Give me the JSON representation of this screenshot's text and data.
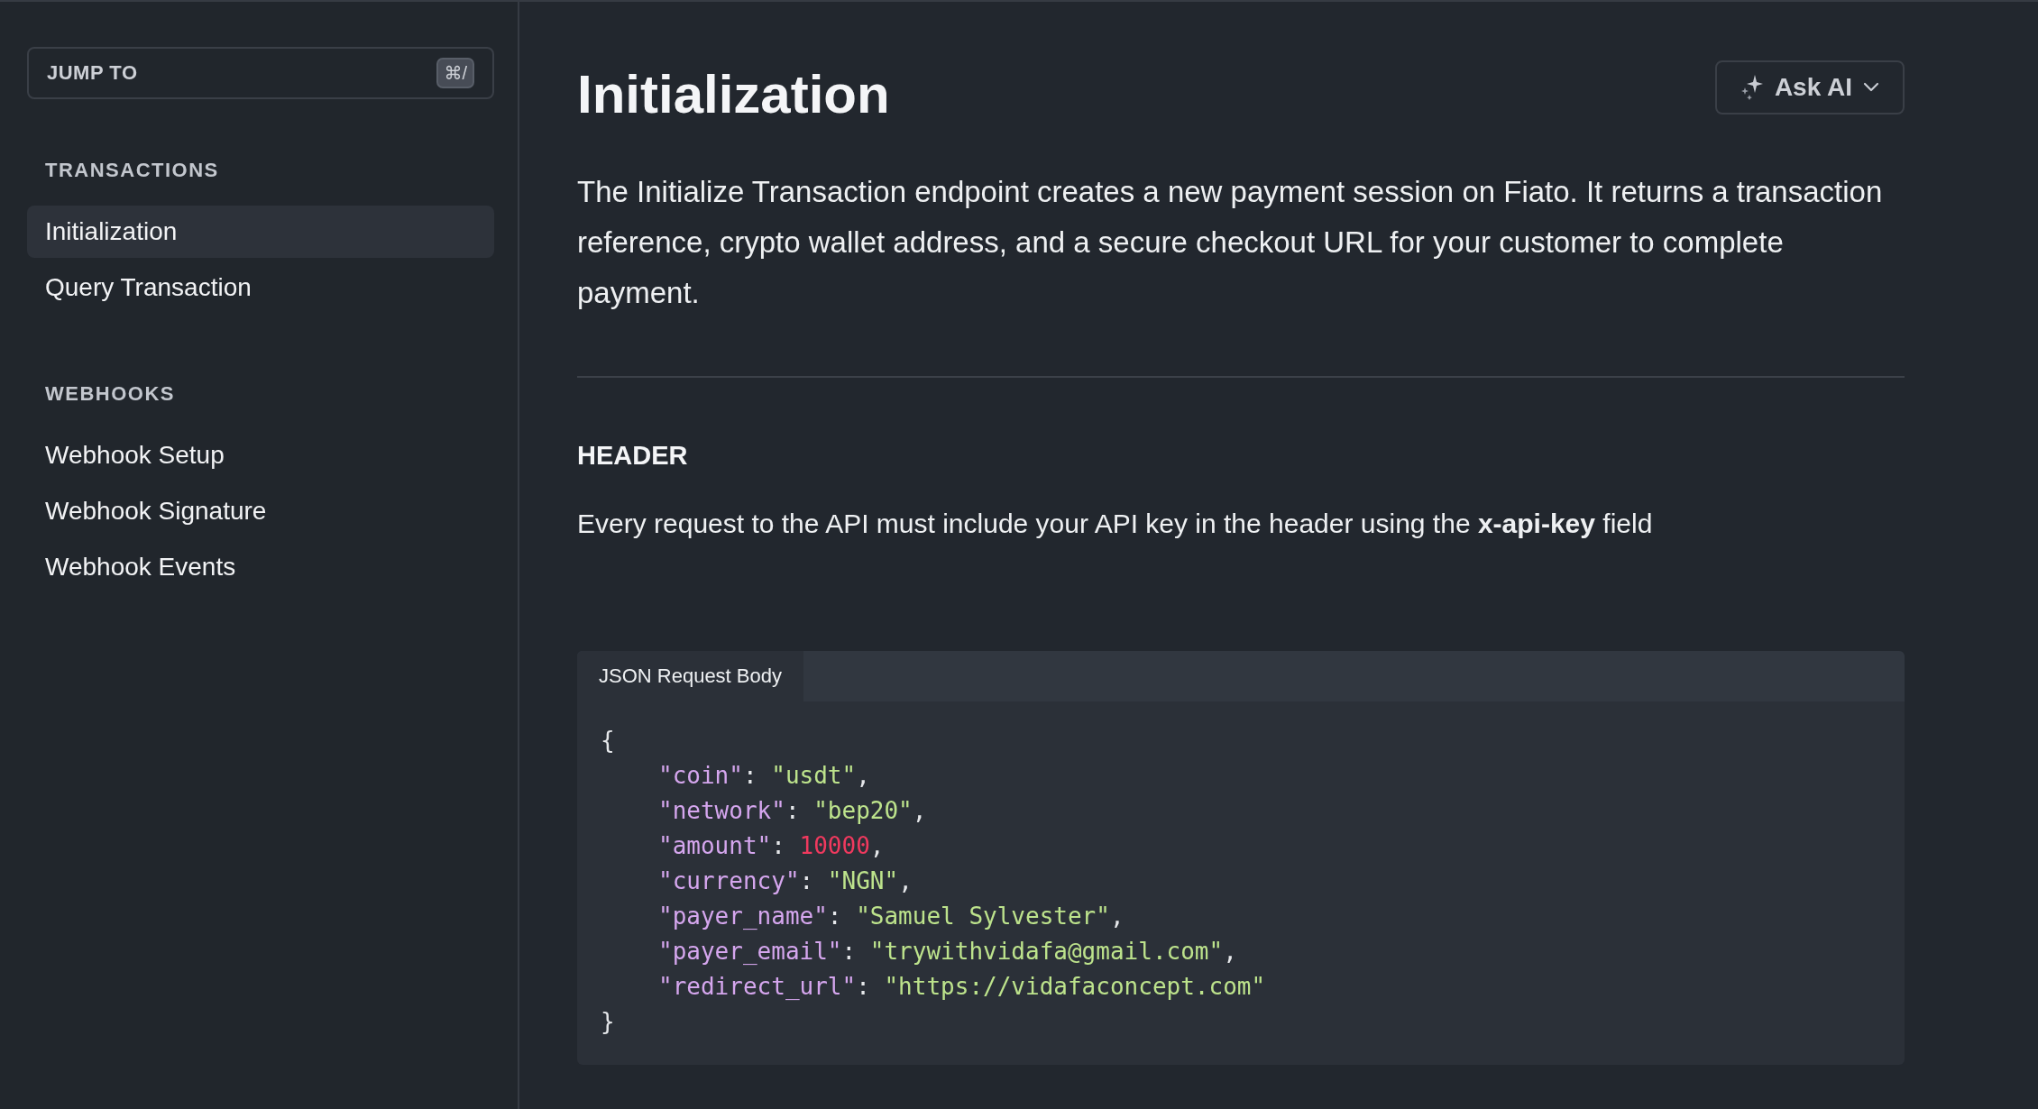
{
  "sidebar": {
    "jump_to": {
      "label": "JUMP TO",
      "shortcut": "⌘/"
    },
    "sections": [
      {
        "title": "TRANSACTIONS",
        "items": [
          {
            "label": "Initialization",
            "selected": true
          },
          {
            "label": "Query Transaction",
            "selected": false
          }
        ]
      },
      {
        "title": "WEBHOOKS",
        "items": [
          {
            "label": "Webhook Setup",
            "selected": false
          },
          {
            "label": "Webhook Signature",
            "selected": false
          },
          {
            "label": "Webhook Events",
            "selected": false
          }
        ]
      }
    ]
  },
  "page": {
    "title": "Initialization",
    "ask_ai": {
      "label": "Ask AI"
    },
    "intro": "The Initialize Transaction endpoint creates a new payment session on Fiato. It returns a transaction reference, crypto wallet address, and a secure checkout URL for your customer to complete payment.",
    "header_section": {
      "title": "HEADER",
      "text": "Every request to the API must include your API key in the header using the **x-api-key** field"
    },
    "code_block": {
      "tab": "JSON Request Body",
      "lines": [
        {
          "indented": false,
          "tokens": [
            {
              "kind": "punct",
              "text": "{"
            }
          ]
        },
        {
          "indented": true,
          "tokens": [
            {
              "kind": "key",
              "text": "\"coin\""
            },
            {
              "kind": "punct",
              "text": ": "
            },
            {
              "kind": "string",
              "text": "\"usdt\""
            },
            {
              "kind": "punct",
              "text": ","
            }
          ]
        },
        {
          "indented": true,
          "tokens": [
            {
              "kind": "key",
              "text": "\"network\""
            },
            {
              "kind": "punct",
              "text": ": "
            },
            {
              "kind": "string",
              "text": "\"bep20\""
            },
            {
              "kind": "punct",
              "text": ","
            }
          ]
        },
        {
          "indented": true,
          "tokens": [
            {
              "kind": "key",
              "text": "\"amount\""
            },
            {
              "kind": "punct",
              "text": ": "
            },
            {
              "kind": "number",
              "text": "10000"
            },
            {
              "kind": "punct",
              "text": ","
            }
          ]
        },
        {
          "indented": true,
          "tokens": [
            {
              "kind": "key",
              "text": "\"currency\""
            },
            {
              "kind": "punct",
              "text": ": "
            },
            {
              "kind": "string",
              "text": "\"NGN\""
            },
            {
              "kind": "punct",
              "text": ","
            }
          ]
        },
        {
          "indented": true,
          "tokens": [
            {
              "kind": "key",
              "text": "\"payer_name\""
            },
            {
              "kind": "punct",
              "text": ": "
            },
            {
              "kind": "string",
              "text": "\"Samuel Sylvester\""
            },
            {
              "kind": "punct",
              "text": ","
            }
          ]
        },
        {
          "indented": true,
          "tokens": [
            {
              "kind": "key",
              "text": "\"payer_email\""
            },
            {
              "kind": "punct",
              "text": ": "
            },
            {
              "kind": "string",
              "text": "\"trywithvidafa@gmail.com\""
            },
            {
              "kind": "punct",
              "text": ","
            }
          ]
        },
        {
          "indented": true,
          "tokens": [
            {
              "kind": "key",
              "text": "\"redirect_url\""
            },
            {
              "kind": "punct",
              "text": ": "
            },
            {
              "kind": "string",
              "text": "\"https://vidafaconcept.com\""
            }
          ]
        },
        {
          "indented": false,
          "tokens": [
            {
              "kind": "punct",
              "text": "}"
            }
          ]
        }
      ]
    }
  }
}
